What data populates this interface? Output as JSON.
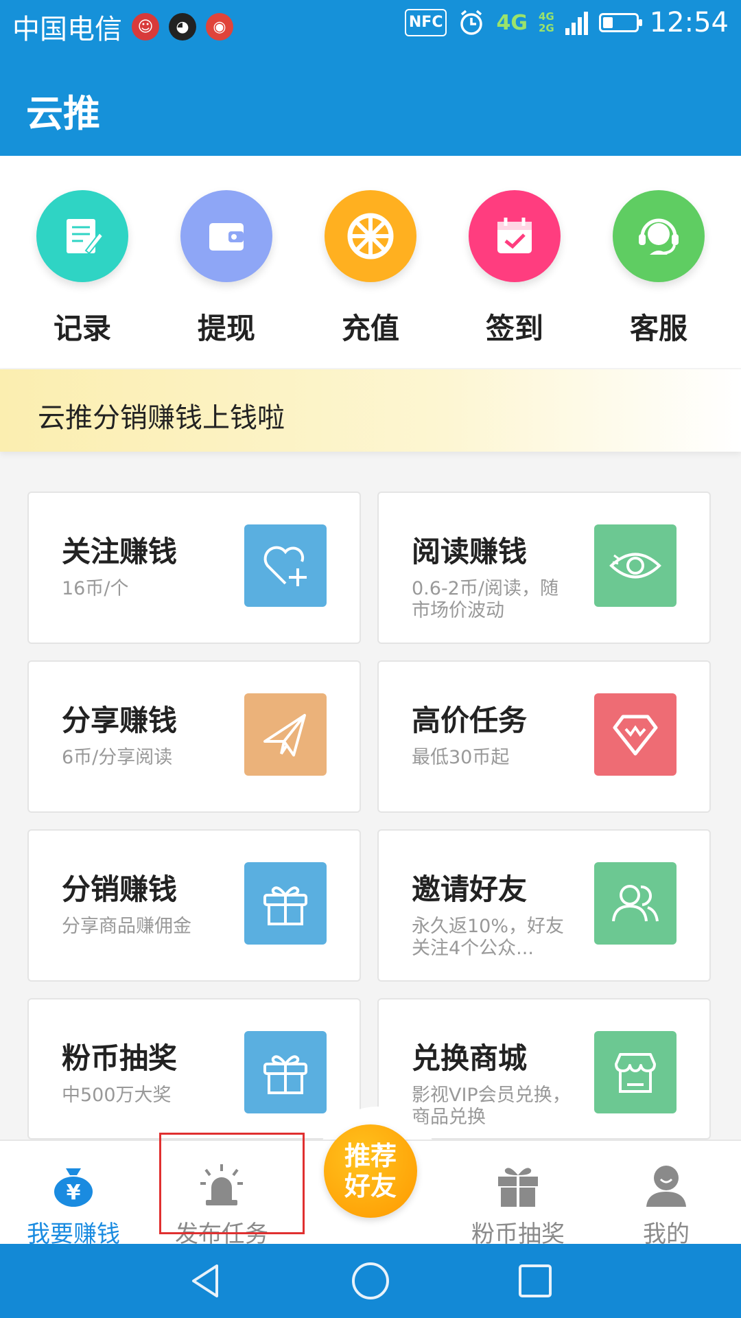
{
  "status_bar": {
    "carrier": "中国电信",
    "nfc": "NFC",
    "network": "4G",
    "network_sub_top": "4G",
    "network_sub_bottom": "2G",
    "battery_level": 0.3,
    "time": "12:54"
  },
  "app_bar": {
    "title": "云推"
  },
  "quick_actions": [
    {
      "label": "记录",
      "icon": "notepad-pen-icon",
      "color": "#2fd4c4"
    },
    {
      "label": "提现",
      "icon": "wallet-icon",
      "color": "#8ea6f6"
    },
    {
      "label": "充值",
      "icon": "wheel-icon",
      "color": "#ffb020"
    },
    {
      "label": "签到",
      "icon": "calendar-check-icon",
      "color": "#ff3d7f"
    },
    {
      "label": "客服",
      "icon": "headset-icon",
      "color": "#5fcd62"
    }
  ],
  "notice": {
    "text": "云推分销赚钱上钱啦"
  },
  "tasks": [
    {
      "title": "关注赚钱",
      "subtitle": "16币/个",
      "icon": "heart-plus-icon",
      "color": "#5aafe0"
    },
    {
      "title": "阅读赚钱",
      "subtitle": "0.6-2币/阅读，随市场价波动",
      "icon": "eye-icon",
      "color": "#6cc892"
    },
    {
      "title": "分享赚钱",
      "subtitle": "6币/分享阅读",
      "icon": "paper-plane-icon",
      "color": "#ebb27a"
    },
    {
      "title": "高价任务",
      "subtitle": "最低30币起",
      "icon": "diamond-icon",
      "color": "#ee6c74"
    },
    {
      "title": "分销赚钱",
      "subtitle": "分享商品赚佣金",
      "icon": "gift-icon",
      "color": "#5aafe0"
    },
    {
      "title": "邀请好友",
      "subtitle": "永久返10%，好友关注4个公众...",
      "icon": "users-icon",
      "color": "#6cc892"
    },
    {
      "title": "粉币抽奖",
      "subtitle": "中500万大奖",
      "icon": "gift-icon",
      "color": "#5aafe0"
    },
    {
      "title": "兑换商城",
      "subtitle": "影视VIP会员兑换，商品兑换",
      "icon": "store-icon",
      "color": "#6cc892"
    }
  ],
  "bottom_nav": {
    "items": [
      {
        "label": "我要赚钱",
        "icon": "money-bag-icon",
        "active": true
      },
      {
        "label": "发布任务",
        "icon": "alarm-light-icon",
        "active": false
      },
      {
        "label": "粉币抽奖",
        "icon": "gift-icon",
        "active": false
      },
      {
        "label": "我的",
        "icon": "user-icon",
        "active": false
      }
    ],
    "center_button": "推荐好友"
  },
  "system_nav": [
    "back-icon",
    "home-icon",
    "recents-icon"
  ],
  "colors": {
    "primary": "#1691d9",
    "active_tab": "#1a8be0",
    "fab": "#ffa500"
  }
}
